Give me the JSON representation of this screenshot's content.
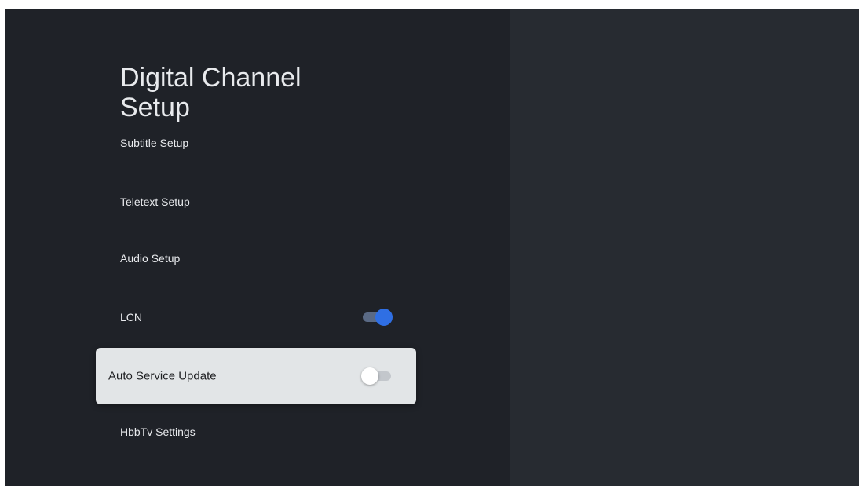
{
  "page": {
    "title": "Digital Channel Setup"
  },
  "menu": {
    "items": [
      {
        "label": "Subtitle Setup",
        "toggle": null,
        "focused": false
      },
      {
        "label": "Teletext Setup",
        "toggle": null,
        "focused": false
      },
      {
        "label": "Audio Setup",
        "toggle": null,
        "focused": false
      },
      {
        "label": "LCN",
        "toggle": "on",
        "focused": false
      },
      {
        "label": "Auto Service Update",
        "toggle": "off",
        "focused": true
      },
      {
        "label": "HbbTv Settings",
        "toggle": null,
        "focused": false
      }
    ]
  },
  "colors": {
    "background_left": "#1f2228",
    "background_right": "#272b31",
    "focus_highlight": "#e2e5e7",
    "toggle_on": "#2f6fe4",
    "text": "#e8eaed"
  }
}
